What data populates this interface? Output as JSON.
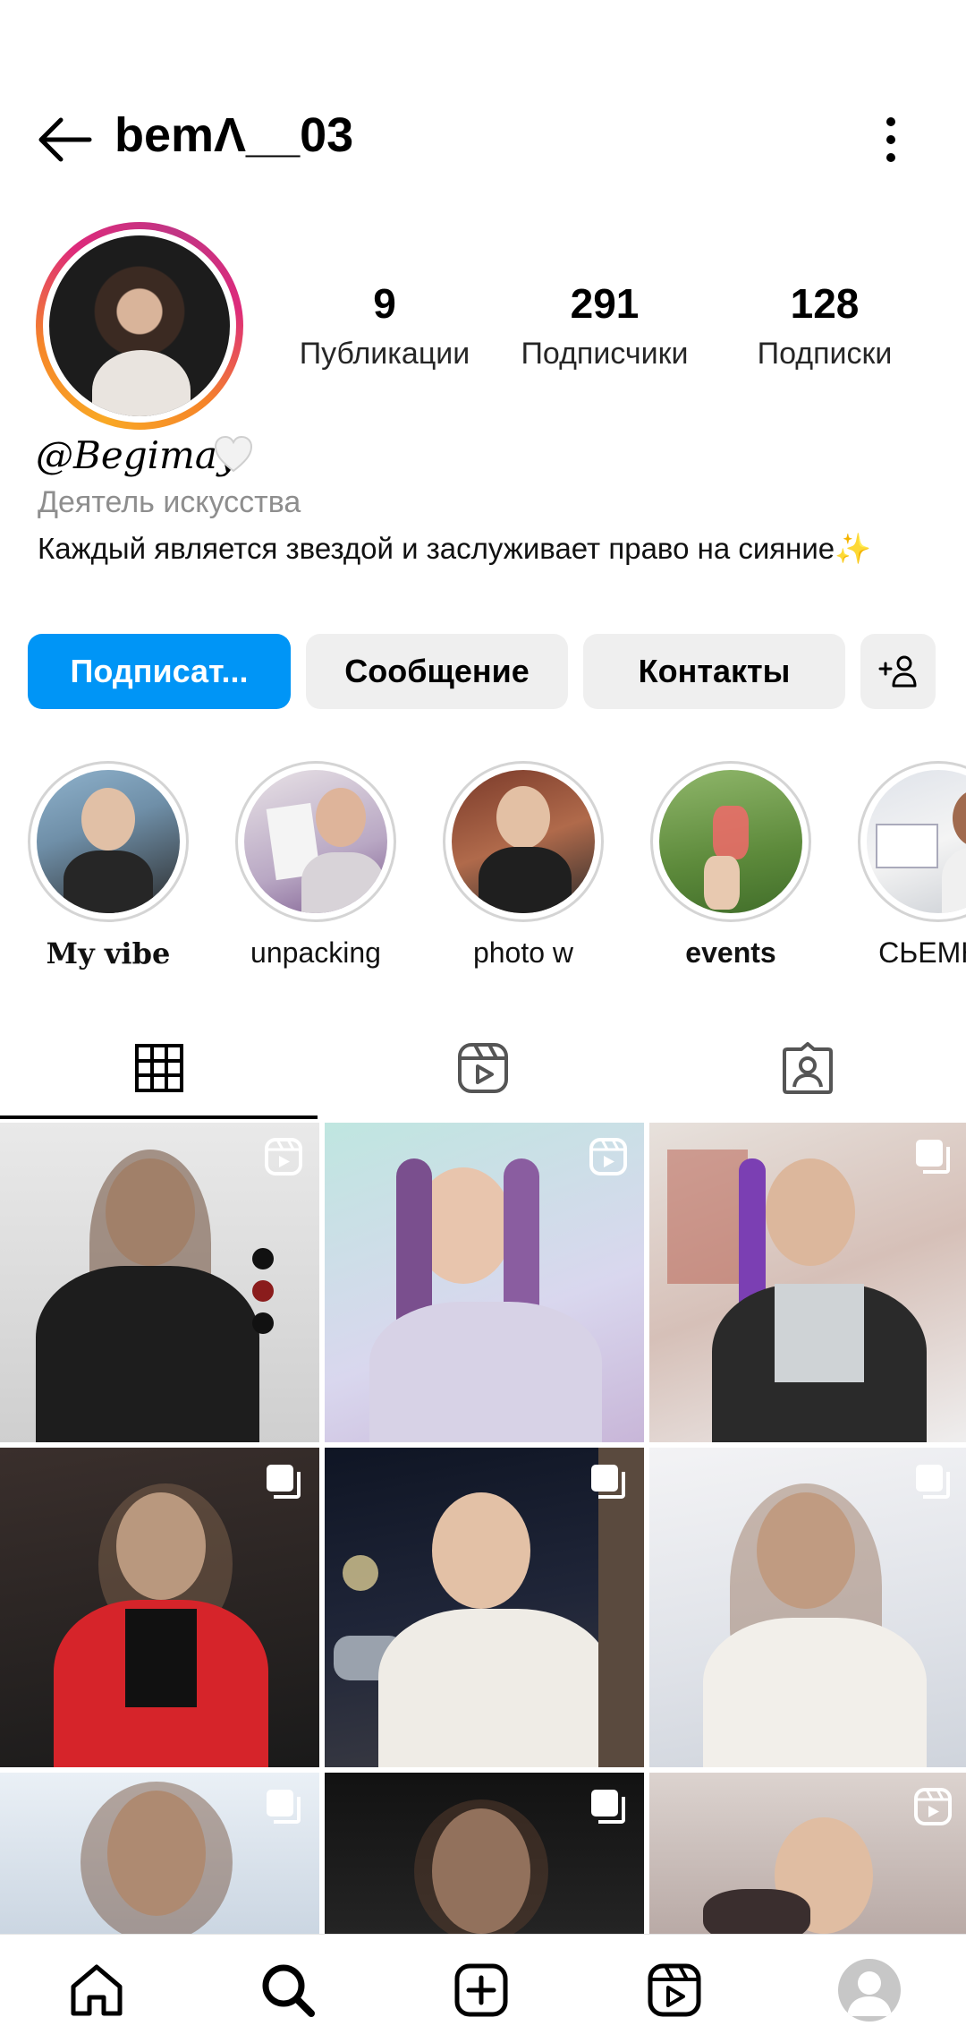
{
  "header": {
    "username": "bemΛ__03"
  },
  "stats": [
    {
      "value": "9",
      "label": "Публикации"
    },
    {
      "value": "291",
      "label": "Подписчики"
    },
    {
      "value": "128",
      "label": "Подписки"
    }
  ],
  "profile": {
    "full_name": "@Begimay",
    "category": "Деятель искусства",
    "bio": "Каждый является звездой и заслуживает право на сияние✨"
  },
  "buttons": {
    "follow": "Подписат...",
    "message": "Сообщение",
    "contacts": "Контакты"
  },
  "highlights": [
    {
      "label": "My vibe"
    },
    {
      "label": "unpacking"
    },
    {
      "label": "photo w"
    },
    {
      "label": "events"
    },
    {
      "label": "СЬЕМКИ"
    }
  ],
  "colors": {
    "accent": "#0095f6",
    "button_bg": "#efefef",
    "muted": "#8e8e8e"
  },
  "icons": {
    "back": "back-arrow-icon",
    "more": "more-vertical-icon",
    "add_user": "add-user-icon",
    "grid_tab": "grid-icon",
    "reels_tab": "reels-icon",
    "tagged_tab": "tagged-icon",
    "nav": [
      "home-icon",
      "search-icon",
      "create-icon",
      "reels-icon",
      "profile-avatar"
    ]
  }
}
